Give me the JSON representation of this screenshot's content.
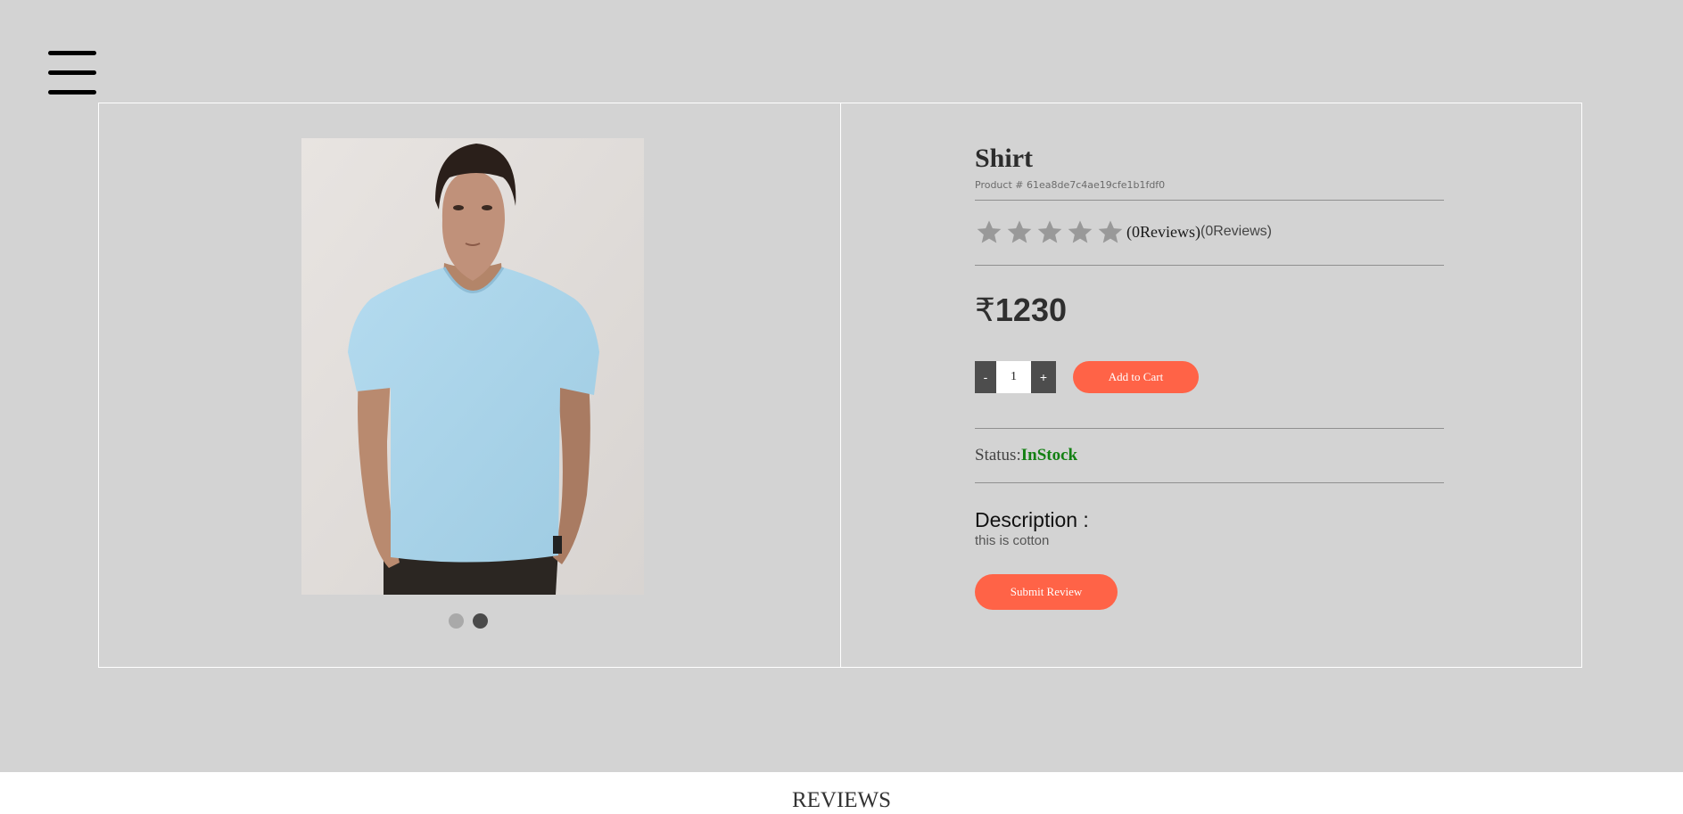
{
  "nav": {
    "menu_icon": "hamburger-menu-icon"
  },
  "product": {
    "name": "Shirt",
    "id_text": "Product # 61ea8de7c4ae19cfe1b1fdf0",
    "rating": 0,
    "max_rating": 5,
    "star_icon": "star-icon",
    "star_color": "#999999",
    "reviews_text_1": "(0Reviews)",
    "reviews_text_2": "(0Reviews)",
    "currency_symbol": "₹",
    "price": "1230",
    "quantity": "1",
    "decrement_label": "-",
    "increment_label": "+",
    "add_to_cart_label": "Add to Cart",
    "status_label": "Status:",
    "status_value": "InStock",
    "status_color": "#138013",
    "description_heading": "Description :",
    "description_text": "this is cotton",
    "submit_review_label": "Submit Review",
    "image": {
      "alt": "product photo (man in light blue t-shirt)",
      "shirt_color": "#acd4ea",
      "slides": 2,
      "active_slide": 2
    }
  },
  "theme": {
    "background": "#d3d3d3",
    "accent": "#ff6347",
    "qty_button": "#4d4d4d"
  },
  "reviews_section": {
    "heading": "REVIEWS"
  }
}
